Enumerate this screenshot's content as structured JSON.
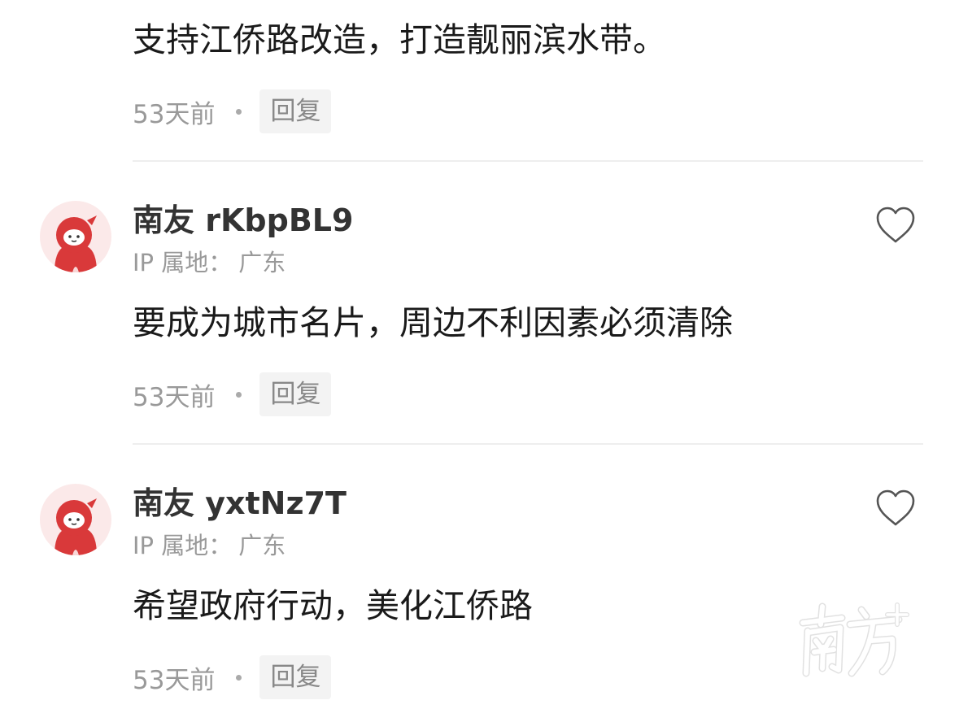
{
  "comments": [
    {
      "username": "",
      "ip_label": "",
      "ip_value": "",
      "body": "支持江侨路改造，打造靓丽滨水带。",
      "time": "53天前",
      "reply_label": "回复"
    },
    {
      "username": "南友 rKbpBL9",
      "ip_label": "IP 属地：",
      "ip_value": "广东",
      "body": "要成为城市名片，周边不利因素必须清除",
      "time": "53天前",
      "reply_label": "回复"
    },
    {
      "username": "南友 yxtNz7T",
      "ip_label": "IP 属地：",
      "ip_value": "广东",
      "body": "希望政府行动，美化江侨路",
      "time": "53天前",
      "reply_label": "回复"
    }
  ],
  "watermark": "南方+",
  "icons": {
    "avatar": "mascot-avatar-icon",
    "like": "heart-outline-icon"
  },
  "colors": {
    "avatar_red": "#d9393a",
    "text_primary": "#1a1a1a",
    "text_muted": "#999999"
  }
}
